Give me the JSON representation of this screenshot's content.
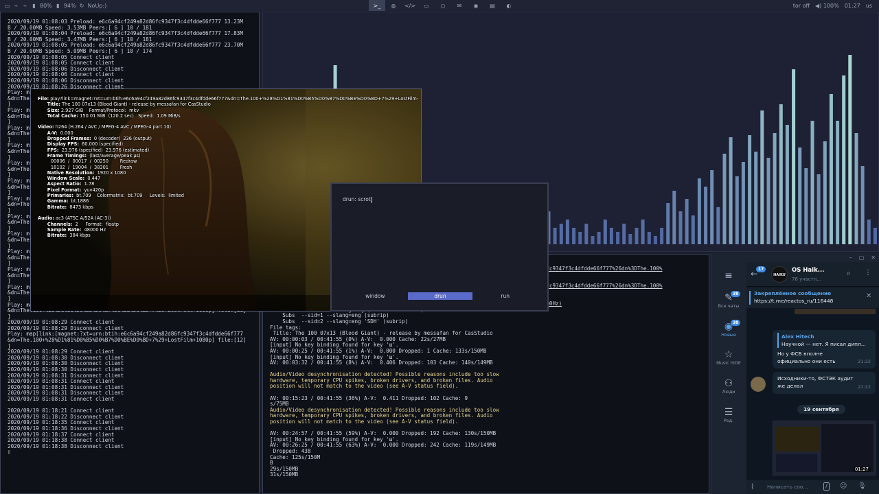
{
  "topbar": {
    "left_items": [
      {
        "icon": "desktop-icon",
        "text": ""
      },
      {
        "icon": "rss-icon",
        "text": ""
      },
      {
        "icon": "rss-icon",
        "text": ""
      },
      {
        "icon": "battery-icon",
        "text": "80%"
      },
      {
        "icon": "memory-icon",
        "text": "94%"
      },
      {
        "icon": "refresh-icon",
        "text": "NoUp:)"
      }
    ],
    "workspaces": [
      {
        "name": "terminal",
        "glyph": ">_",
        "active": true
      },
      {
        "name": "web",
        "glyph": "◍",
        "active": false
      },
      {
        "name": "code",
        "glyph": "</>",
        "active": false
      },
      {
        "name": "files",
        "glyph": "▭",
        "active": false
      },
      {
        "name": "chat",
        "glyph": "○",
        "active": false
      },
      {
        "name": "mail",
        "glyph": "✉",
        "active": false
      },
      {
        "name": "view",
        "glyph": "◉",
        "active": false
      },
      {
        "name": "media",
        "glyph": "▤",
        "active": false
      },
      {
        "name": "system",
        "glyph": "◐",
        "active": false
      }
    ],
    "tor": "tor off",
    "volume": "100%",
    "clock": "01:27",
    "layout": "us"
  },
  "left_terminal": {
    "lines": [
      "2020/09/19 01:08:03 Preload: e6c6a94cf249a82d86fc9347f3c4dfdde66f777 13.23M",
      "B / 20.00MB Speed: 3.53MB Peers:[ 6 ] 10 / 181",
      "2020/09/19 01:08:04 Preload: e6c6a94cf249a82d86fc9347f3c4dfdde66f777 17.83M",
      "B / 20.00MB Speed: 3.47MB Peers:[ 6 ] 10 / 181",
      "2020/09/19 01:08:05 Preload: e6c6a94cf249a82d86fc9347f3c4dfdde66f777 23.70M",
      "B / 20.00MB Speed: 5.09MB Peers:[ 6 ] 10 / 174",
      "2020/09/19 01:08:05 Connect client",
      "2020/09/19 01:08:05 Connect client",
      "2020/09/19 01:08:06 Disconnect client",
      "2020/09/19 01:08:06 Connect client",
      "2020/09/19 01:08:06 Disconnect client",
      "2020/09/19 01:08:26 Disconnect client",
      "Play: m",
      "&dn=The",
      "]",
      "Play: m",
      "&dn=The",
      "]",
      "Play: m",
      "&dn=The",
      "]",
      "Play: m",
      "&dn=The",
      "]",
      "Play: m",
      "&dn=The",
      "]",
      "Play: m",
      "&dn=The",
      "]",
      "Play: m",
      "&dn=The",
      "]",
      "Play: m",
      "&dn=The",
      "]",
      "Play: m",
      "&dn=The",
      "]",
      "Play: m",
      "&dn=The",
      "]",
      "Play: m",
      "&dn=The",
      "]",
      "Play: m",
      "&dn=The",
      "]",
      "Play: map[link:[magnet:?xt=urn:btih:e6c6a94cf249a82d86fc9347f3c4dfdde66f777",
      "&dn=The.100+%28%D1%81%D0%B5%D0%B7%D0%BE%D0%BD+7%29+LostFilm+1080p] file:[11]",
      "]",
      "2020/09/19 01:08:29 Connect client",
      "2020/09/19 01:08:29 Disconnect client",
      "Play: map[link:[magnet:?xt=urn:btih:e6c6a94cf249a82d86fc9347f3c4dfdde66f777",
      "&dn=The.100+%28%D1%81%D0%B5%D0%B7%D0%BE%D0%BD+7%29+LostFilm+1080p] file:[12]",
      "]",
      "2020/09/19 01:08:29 Connect client",
      "2020/09/19 01:08:30 Disconnect client",
      "2020/09/19 01:08:30 Disconnect client",
      "2020/09/19 01:08:30 Disconnect client",
      "2020/09/19 01:08:31 Disconnect client",
      "2020/09/19 01:08:31 Connect client",
      "2020/09/19 01:08:31 Disconnect client",
      "2020/09/19 01:08:31 Disconnect client",
      "2020/09/19 01:08:31 Connect client",
      "",
      "2020/09/19 01:18:21 Connect client",
      "2020/09/19 01:18:22 Disconnect client",
      "2020/09/19 01:18:35 Connect client",
      "2020/09/19 01:18:36 Disconnect client",
      "2020/09/19 01:18:37 Connect client",
      "2020/09/19 01:18:38 Connect client",
      "2020/09/19 01:18:38 Disconnect client",
      "▯"
    ]
  },
  "right_terminal": {
    "lines": [
      "                                                            ..................p=10",
      "                                                            ..................f249a82d86fc9347f3c4dfdde66f777%26dn%3DThe.100%",
      "                                                            ..................p=11",
      "",
      "                                                            ..................f249a82d86fc9347f3c4dfdde66f777%26dn%3DThe.100%",
      "                                                            ..................p=12",
      "",
      "                                                            ..................c3 2ch 48000Hz)",
      "    Audio  --aid=2 --alang=eng (eac3 6ch 48000Hz)",
      "    Subs  --sid=1 --slang=eng (subrip)",
      "    Subs  --sid=2 --slang=eng 'SDH' (subrip)",
      "File tags:",
      " Title: The 100 07x13 (Blood Giant) - release by messafan for CasStudio",
      "AV: 00:00:03 / 00:41:55 (0%) A-V:  0.000 Cache: 22s/27MB",
      "[input] No key binding found for key 'ш'.",
      "AV: 00:00:25 / 00:41:55 (1%) A-V:  0.000 Dropped: 1 Cache: 133s/150MB",
      "[input] No key binding found for key 'ш'.",
      "AV: 00:03:32 / 00:41:55 (8%) A-V:  0.406 Dropped: 103 Cache: 140s/149MB",
      "",
      "Audio/Video desynchronisation detected! Possible reasons include too slow",
      "hardware, temporary CPU spikes, broken drivers, and broken files. Audio",
      "position will not match to the video (see A-V status field).",
      "",
      "AV: 00:15:23 / 00:41:55 (36%) A-V:  0.411 Dropped: 102 Cache: 9",
      "s/75MB",
      "Audio/Video desynchronisation detected! Possible reasons include too slow",
      "hardware, temporary CPU spikes, broken drivers, and broken files. Audio",
      "position will not match to the video (see A-V status field).",
      "",
      "AV: 00:24:57 / 00:41:55 (59%) A-V:  0.000 Dropped: 192 Cache: 130s/150MB",
      "[input] No key binding found for key 'ш'.",
      "AV: 00:26:25 / 00:41:55 (63%) A-V:  0.000 Dropped: 242 Cache: 119s/149MB",
      " Dropped: 438",
      "Cache: 125s/150M",
      "B",
      "29s/150MB",
      "31s/150MB"
    ]
  },
  "visualizer": {
    "bars": [
      0,
      0,
      0,
      0,
      0,
      0.06,
      0,
      0.72,
      0,
      0,
      0,
      0.87,
      0,
      0,
      0,
      0,
      0,
      0,
      0,
      0,
      0,
      0,
      0,
      0,
      0,
      0,
      0,
      0.3,
      0,
      0,
      0,
      0,
      0,
      0.04,
      0.02,
      0.05,
      0.03,
      0.06,
      0.05,
      0.04,
      0.1,
      0.06,
      0.08,
      0.05,
      0.1,
      0.16,
      0.08,
      0.1,
      0.12,
      0.08,
      0.06,
      0.1,
      0.04,
      0.06,
      0.12,
      0.08,
      0.06,
      0.1,
      0.05,
      0.08,
      0.12,
      0.06,
      0.04,
      0.08,
      0.2,
      0.26,
      0.16,
      0.22,
      0.14,
      0.32,
      0.28,
      0.36,
      0.18,
      0.44,
      0.52,
      0.33,
      0.4,
      0.53,
      0.45,
      0.65,
      0.42,
      0.54,
      0.68,
      0.58,
      0.85,
      0.47,
      0.37,
      0.6,
      0.34,
      0.5,
      0.73,
      0.6,
      0.82,
      0.92,
      0.54,
      0.38,
      0.12,
      0.08
    ],
    "color_low": "#4b5f9e",
    "color_high": "#a9d8d4"
  },
  "video": {
    "osd": [
      {
        "label": "File:",
        "value": " play?link=magnet:?xt=urn:btih:e6c6a94cf249a82d86fc9347f3c4dfdde66f777&dn=The.100+%28%D1%81%D0%B5%D0%B7%D0%BE%D0%BD+7%29+LostFilm-"
      },
      {
        "label": "      Title:",
        "value": " The 100 07x13 (Blood Giant) - release by messafan for CasStudio"
      },
      {
        "label": "      Size:",
        "value": " 2.927 GiB    Format/Protocol:  mkv"
      },
      {
        "label": "      Total Cache:",
        "value": " 150.01 MiB  (120.2 sec)   Speed:  1.09 MiB/s"
      },
      {
        "label": "",
        "value": ""
      },
      {
        "label": "Video:",
        "value": " h264 (H.264 / AVC / MPEG-4 AVC / MPEG-4 part 10)"
      },
      {
        "label": "      A-V:",
        "value": "  0.000"
      },
      {
        "label": "      Dropped Frames:",
        "value": "  0 (decoder)  236 (output)"
      },
      {
        "label": "      Display FPS:",
        "value": "  60.000 (specified)"
      },
      {
        "label": "      FPS:",
        "value": "  23.976 (specified)  23.976 (estimated)"
      },
      {
        "label": "      Frame Timings:",
        "value": "  (last/average/peak μs)"
      },
      {
        "label": "",
        "value": "         00006  /  00017  /  00250        Redraw"
      },
      {
        "label": "",
        "value": "         18102  /  19004  /  38301        Fresh"
      },
      {
        "label": "      Native Resolution:",
        "value": "  1920 x 1080"
      },
      {
        "label": "      Window Scale:",
        "value": "  0.447"
      },
      {
        "label": "      Aspect Ratio:",
        "value": "  1.78"
      },
      {
        "label": "      Pixel Format:",
        "value": "  yuv420p"
      },
      {
        "label": "      Primaries:",
        "value": "  bt.709    Colormatrix:  bt.709     Levels:  limited"
      },
      {
        "label": "      Gamma:",
        "value": "  bt.1886"
      },
      {
        "label": "      Bitrate:",
        "value": "  8473 kbps"
      },
      {
        "label": "",
        "value": ""
      },
      {
        "label": "Audio:",
        "value": " ac3 (ATSC A/52A (AC-3))"
      },
      {
        "label": "      Channels:",
        "value": "  2     Format:  floatp"
      },
      {
        "label": "      Sample Rate:",
        "value": "  48000 Hz"
      },
      {
        "label": "      Bitrate:",
        "value": "  384 kbps"
      }
    ]
  },
  "rofi": {
    "prompt": "drun:",
    "query": "scrot",
    "modes": [
      {
        "label": "window",
        "selected": false
      },
      {
        "label": "drun",
        "selected": true
      },
      {
        "label": "run",
        "selected": false
      }
    ]
  },
  "telegram": {
    "window_controls": [
      "–",
      "▢",
      "✕"
    ],
    "sidebar": [
      {
        "name": "all-chats",
        "glyph": "✎",
        "label": "Все чаты",
        "badge": "38",
        "active": false
      },
      {
        "name": "new",
        "glyph": "◉",
        "label": "Новые",
        "badge": "38",
        "active": true
      },
      {
        "name": "music-hide",
        "glyph": "☆",
        "label": "Music hIDE",
        "badge": "",
        "active": false
      },
      {
        "name": "people",
        "glyph": "⚇",
        "label": "Люди",
        "badge": "",
        "active": false
      },
      {
        "name": "edit",
        "glyph": "☰",
        "label": "Ред.",
        "badge": "",
        "active": false
      }
    ],
    "menu_glyph": "≡",
    "back_badge": "17",
    "chat_title": "OS Haik...",
    "chat_subtitle": "76 участн...",
    "avatar_text": "HAIKU",
    "pinned_title": "Закреплённое сообщение",
    "pinned_text": "https://t.me/reactos_ru/116448",
    "messages": [
      {
        "author": "Alex Hitech",
        "quote": "Научной — нет. Я писал дипл...",
        "text": "Но у ФСБ вполне официально они есть",
        "time": "21:22"
      },
      {
        "author": "",
        "quote": "",
        "text": "Исходники-то, ФСТЭК аудит же делал",
        "time": "21:22"
      }
    ],
    "date_separator": "19 сентября",
    "image_time": "01:27",
    "input_placeholder": "Написать соо...",
    "accent": "#5aa4e8"
  }
}
